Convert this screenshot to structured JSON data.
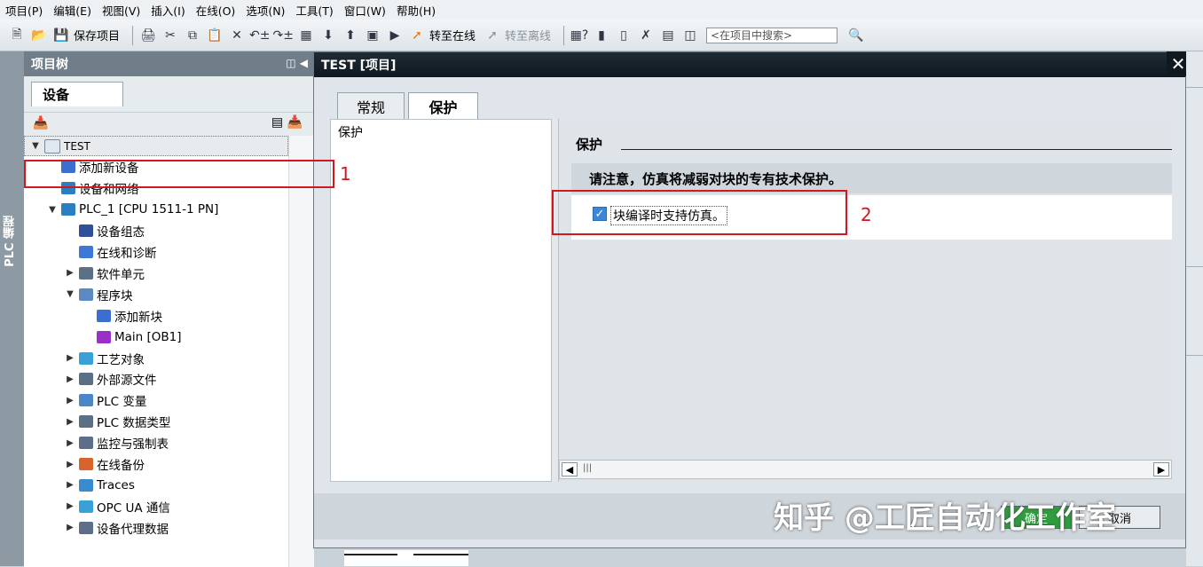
{
  "menu": [
    "项目(P)",
    "编辑(E)",
    "视图(V)",
    "插入(I)",
    "在线(O)",
    "选项(N)",
    "工具(T)",
    "窗口(W)",
    "帮助(H)"
  ],
  "toolbar": {
    "save_label": "保存项目",
    "go_online": "转至在线",
    "go_offline": "转至离线",
    "search_placeholder": "<在项目中搜索>"
  },
  "sidebar_vertical_label": "PLC 编程",
  "project_tree": {
    "title": "项目树",
    "tab": "设备",
    "items": [
      {
        "label": "TEST",
        "level": 0,
        "expand": "open",
        "icon": "project-icon",
        "color": "#dfe8f0"
      },
      {
        "label": "添加新设备",
        "level": 1,
        "expand": "none",
        "icon": "add-device-icon",
        "color": "#3a6fd0"
      },
      {
        "label": "设备和网络",
        "level": 1,
        "expand": "none",
        "icon": "network-icon",
        "color": "#2a7fc1"
      },
      {
        "label": "PLC_1 [CPU 1511-1 PN]",
        "level": 1,
        "expand": "open",
        "icon": "plc-icon",
        "color": "#2a7fc1"
      },
      {
        "label": "设备组态",
        "level": 2,
        "expand": "none",
        "icon": "device-config-icon",
        "color": "#2f4f9a"
      },
      {
        "label": "在线和诊断",
        "level": 2,
        "expand": "none",
        "icon": "diagnostics-icon",
        "color": "#3a7ad6"
      },
      {
        "label": "软件单元",
        "level": 2,
        "expand": "closed",
        "icon": "software-unit-icon",
        "color": "#5b6f86"
      },
      {
        "label": "程序块",
        "level": 2,
        "expand": "open",
        "icon": "program-blocks-icon",
        "color": "#5a8ac0"
      },
      {
        "label": "添加新块",
        "level": 3,
        "expand": "none",
        "icon": "add-block-icon",
        "color": "#3a6fd0"
      },
      {
        "label": "Main [OB1]",
        "level": 3,
        "expand": "none",
        "icon": "ob-block-icon",
        "color": "#9b2fc7"
      },
      {
        "label": "工艺对象",
        "level": 2,
        "expand": "closed",
        "icon": "technology-objects-icon",
        "color": "#3aa0d8"
      },
      {
        "label": "外部源文件",
        "level": 2,
        "expand": "closed",
        "icon": "external-source-icon",
        "color": "#5b6f86"
      },
      {
        "label": "PLC 变量",
        "level": 2,
        "expand": "closed",
        "icon": "plc-tags-icon",
        "color": "#4a86c8"
      },
      {
        "label": "PLC 数据类型",
        "level": 2,
        "expand": "closed",
        "icon": "plc-datatypes-icon",
        "color": "#5b6f86"
      },
      {
        "label": "监控与强制表",
        "level": 2,
        "expand": "closed",
        "icon": "watch-tables-icon",
        "color": "#5b6f86"
      },
      {
        "label": "在线备份",
        "level": 2,
        "expand": "closed",
        "icon": "online-backup-icon",
        "color": "#d8642a"
      },
      {
        "label": "Traces",
        "level": 2,
        "expand": "closed",
        "icon": "traces-icon",
        "color": "#3a8ad0"
      },
      {
        "label": "OPC UA 通信",
        "level": 2,
        "expand": "closed",
        "icon": "opcua-icon",
        "color": "#3aa0d8"
      },
      {
        "label": "设备代理数据",
        "level": 2,
        "expand": "closed",
        "icon": "device-proxy-icon",
        "color": "#5b6f86"
      }
    ]
  },
  "dialog": {
    "title": "TEST [项目]",
    "tabs": [
      "常规",
      "保护"
    ],
    "nav_item": "保护",
    "section_title": "保护",
    "note": "请注意，仿真将减弱对块的专有技术保护。",
    "checkbox_label": "块编译时支持仿真。",
    "checkbox_checked": true,
    "ok_label": "确定",
    "cancel_label": "取消"
  },
  "annotations": {
    "label1": "1",
    "label2": "2",
    "color": "#d0181d"
  },
  "watermark": "知乎 @工匠自动化工作室"
}
